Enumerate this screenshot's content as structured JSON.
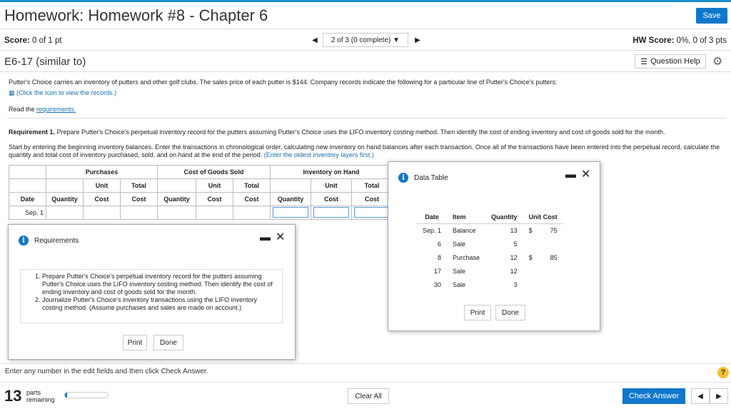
{
  "header": {
    "title": "Homework: Homework #8 - Chapter 6",
    "save_label": "Save"
  },
  "status": {
    "score_label": "Score:",
    "score_value": "0 of 1 pt",
    "nav_label": "2 of 3 (0 complete)",
    "hw_score_label": "HW Score:",
    "hw_score_value": "0%, 0 of 3 pts"
  },
  "exercise": {
    "title": "E6-17 (similar to)",
    "question_help_label": "Question Help"
  },
  "question": {
    "intro": "Putter's Choice carries an inventory of putters and other golf clubs. The sales price of each putter is $144. Company records indicate the following for a particular line of Putter's Choice's putters:",
    "click_icon_text": "(Click the icon to view the records.)",
    "read_prefix": "Read the",
    "read_link": "requirements.",
    "req1_label": "Requirement 1.",
    "req1_text": "Prepare Putter's Choice's perpetual inventory record for the putters assuming Putter's Choice uses the LIFO inventory costing method. Then identify the cost of ending inventory and cost of goods sold for the month.",
    "start_text": "Start by entering the beginning inventory balances. Enter the transactions in chronological order, calculating new inventory on hand balances after each transaction. Once all of the transactions have been entered into the perpetual record, calculate the quantity and total cost of inventory purchased, sold, and on hand at the end of the period.",
    "start_note": "(Enter the oldest inventory layers first.)"
  },
  "inventory_table": {
    "group_headers": [
      "Purchases",
      "Cost of Goods Sold",
      "Inventory on Hand"
    ],
    "sub_headers_unit": "Unit",
    "sub_headers_total": "Total",
    "columns": [
      "Date",
      "Quantity",
      "Cost",
      "Cost",
      "Quantity",
      "Cost",
      "Cost",
      "Quantity",
      "Cost",
      "Cost"
    ],
    "first_row_date": "Sep. 1"
  },
  "data_table": {
    "title": "Data Table",
    "headers": [
      "Date",
      "Item",
      "Quantity",
      "Unit Cost"
    ],
    "rows": [
      {
        "date": "Sep. 1",
        "item": "Balance",
        "qty": "13",
        "cur": "$",
        "cost": "75"
      },
      {
        "date": "6",
        "item": "Sale",
        "qty": "5",
        "cur": "",
        "cost": ""
      },
      {
        "date": "8",
        "item": "Purchase",
        "qty": "12",
        "cur": "$",
        "cost": "85"
      },
      {
        "date": "17",
        "item": "Sale",
        "qty": "12",
        "cur": "",
        "cost": ""
      },
      {
        "date": "30",
        "item": "Sale",
        "qty": "3",
        "cur": "",
        "cost": ""
      }
    ],
    "print_label": "Print",
    "done_label": "Done"
  },
  "requirements": {
    "title": "Requirements",
    "items": [
      "Prepare Putter's Choice's perpetual inventory record for the putters assuming Putter's Choice uses the LIFO inventory costing method. Then identify the cost of ending inventory and cost of goods sold for the month.",
      "Journalize Putter's Choice's inventory transactions using the LIFO inventory costing method. (Assume purchases and sales are made on account.)"
    ],
    "print_label": "Print",
    "done_label": "Done"
  },
  "footer": {
    "message": "Enter any number in the edit fields and then click Check Answer.",
    "parts_count": "13",
    "parts_label_1": "parts",
    "parts_label_2": "remaining",
    "progress_fraction": 0.05,
    "clear_all_label": "Clear All",
    "check_answer_label": "Check Answer"
  },
  "colors": {
    "accent": "#1177cc",
    "help": "#f2c12e"
  },
  "icons": [
    "info-icon",
    "gear-icon",
    "list-icon",
    "table-icon",
    "close-icon",
    "minimize-icon",
    "help-icon"
  ]
}
